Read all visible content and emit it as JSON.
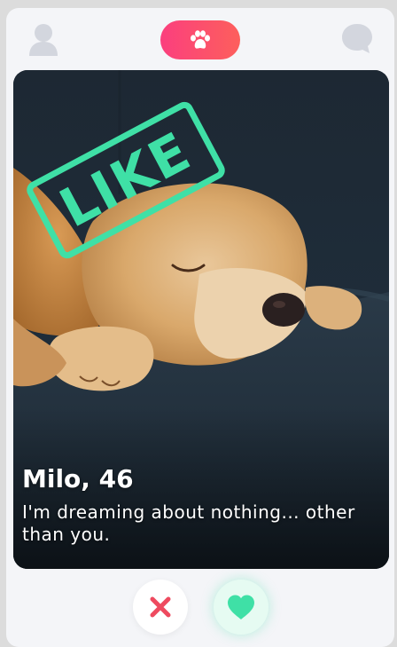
{
  "header": {
    "profile_icon": "user-icon",
    "center_icon": "paw-icon",
    "chat_icon": "chat-bubble-icon"
  },
  "card": {
    "stamp": "LIKE",
    "name": "Milo, 46",
    "bio": "I'm dreaming about nothing... other than you."
  },
  "actions": {
    "dislike_icon": "close-icon",
    "like_icon": "heart-icon"
  },
  "colors": {
    "accent_pink": "#fb3f7e",
    "accent_coral": "#fd5f5c",
    "like_green": "#3fe0a6",
    "icon_gray": "#d3d6de",
    "dislike_red": "#ee4a5f"
  }
}
